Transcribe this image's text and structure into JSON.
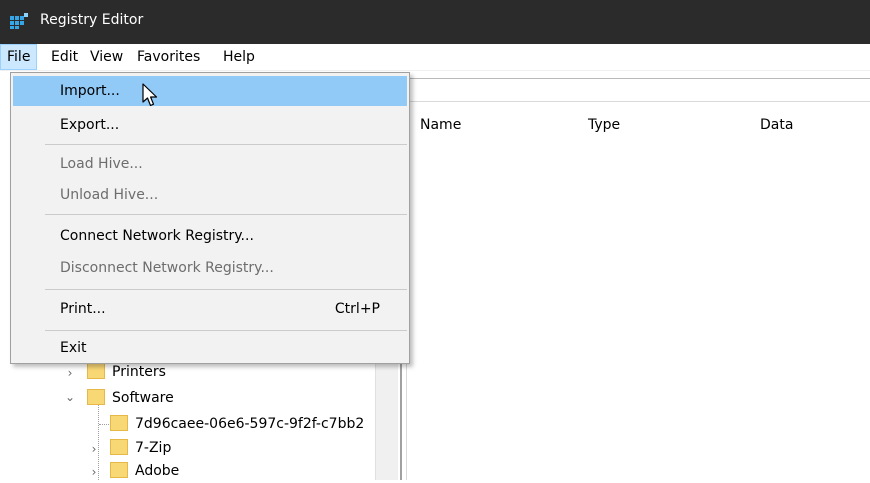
{
  "window": {
    "title": "Registry Editor"
  },
  "menubar": {
    "items": [
      "File",
      "Edit",
      "View",
      "Favorites",
      "Help"
    ],
    "active": "File"
  },
  "columns": {
    "name": "Name",
    "type": "Type",
    "data": "Data"
  },
  "file_menu": {
    "import": "Import...",
    "export": "Export...",
    "load_hive": "Load Hive...",
    "unload_hive": "Unload Hive...",
    "connect_network": "Connect Network Registry...",
    "disconnect_network": "Disconnect Network Registry...",
    "print": "Print...",
    "print_shortcut": "Ctrl+P",
    "exit": "Exit",
    "highlighted": "Import...",
    "disabled": [
      "Load Hive...",
      "Unload Hive...",
      "Disconnect Network Registry..."
    ]
  },
  "tree": {
    "printers": "Printers",
    "software": "Software",
    "child_key": "7d96caee-06e6-597c-9f2f-c7bb2",
    "zip": "7-Zip",
    "adobe": "Adobe"
  },
  "icons": [
    "regedit-icon",
    "chevron-right-icon",
    "chevron-down-icon",
    "folder-icon",
    "mouse-pointer-icon"
  ],
  "colors": {
    "titlebar": "#2b2b2b",
    "menu_highlight": "#91c9f7",
    "active_menu": "#cce8ff",
    "folder": "#f8d775"
  }
}
